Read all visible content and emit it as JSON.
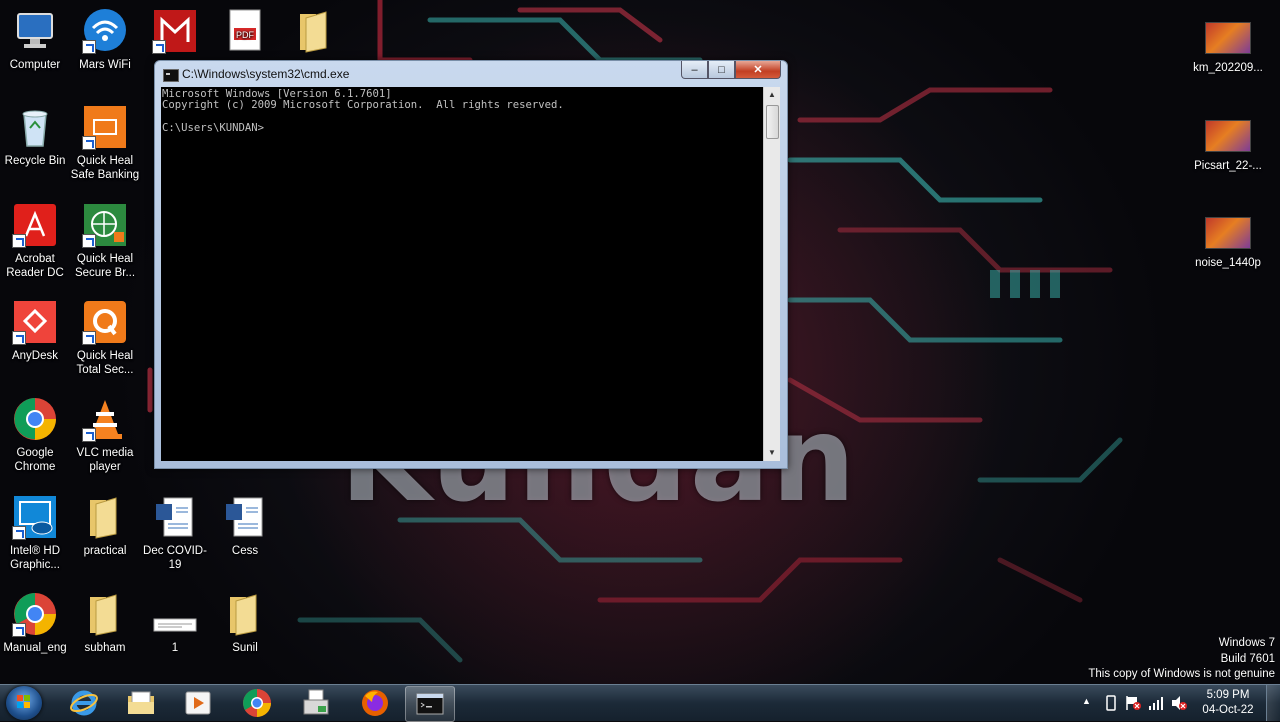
{
  "desktop": {
    "wallpaper_text": "Kundan",
    "left_icons": [
      {
        "label": "Computer",
        "icon": "computer-icon"
      },
      {
        "label": "Mars WiFi",
        "icon": "wifi-icon"
      },
      {
        "label": "Recycle Bin",
        "icon": "recycle-bin-icon"
      },
      {
        "label": "Quick Heal Safe Banking",
        "icon": "safe-banking-icon"
      },
      {
        "label": "Acrobat Reader DC",
        "icon": "acrobat-icon"
      },
      {
        "label": "Quick Heal Secure Br...",
        "icon": "secure-browser-icon"
      },
      {
        "label": "AnyDesk",
        "icon": "anydesk-icon"
      },
      {
        "label": "Quick Heal Total Sec...",
        "icon": "quick-heal-icon"
      },
      {
        "label": "Google Chrome",
        "icon": "chrome-icon"
      },
      {
        "label": "VLC media player",
        "icon": "vlc-icon"
      },
      {
        "label": "Intel® HD Graphic...",
        "icon": "intel-icon"
      },
      {
        "label": "practical",
        "icon": "folder-icon"
      },
      {
        "label": "Dec COVID-19",
        "icon": "word-doc-icon"
      },
      {
        "label": "Cess",
        "icon": "word-doc-icon"
      },
      {
        "label": "Manual_eng",
        "icon": "chrome-icon"
      },
      {
        "label": "subham",
        "icon": "folder-icon"
      },
      {
        "label": "1",
        "icon": "image-file-icon"
      },
      {
        "label": "Sunil",
        "icon": "folder-icon"
      }
    ],
    "right_icons": [
      {
        "label": "km_202209...",
        "icon": "video-file-icon"
      },
      {
        "label": "Picsart_22-...",
        "icon": "video-file-icon"
      },
      {
        "label": "noise_1440p",
        "icon": "video-file-icon"
      }
    ]
  },
  "cmd_window": {
    "title": "C:\\Windows\\system32\\cmd.exe",
    "minimize_label": "–",
    "maximize_label": "□",
    "close_label": "✕",
    "console_lines": "Microsoft Windows [Version 6.1.7601]\nCopyright (c) 2009 Microsoft Corporation.  All rights reserved.\n\nC:\\Users\\KUNDAN>"
  },
  "watermark": {
    "line1": "Windows 7",
    "line2": "Build 7601",
    "line3": "This copy of Windows is not genuine"
  },
  "taskbar": {
    "items": [
      "internet-explorer-icon",
      "file-explorer-icon",
      "media-player-icon",
      "chrome-icon",
      "fax-scan-icon",
      "firefox-icon",
      "cmd-icon"
    ],
    "time": "5:09 PM",
    "date": "04-Oct-22"
  },
  "colors": {
    "console_bg": "#000000",
    "console_text": "#c0c0c0",
    "close_button": "#c23f23",
    "taskbar": "#1c2a38"
  }
}
